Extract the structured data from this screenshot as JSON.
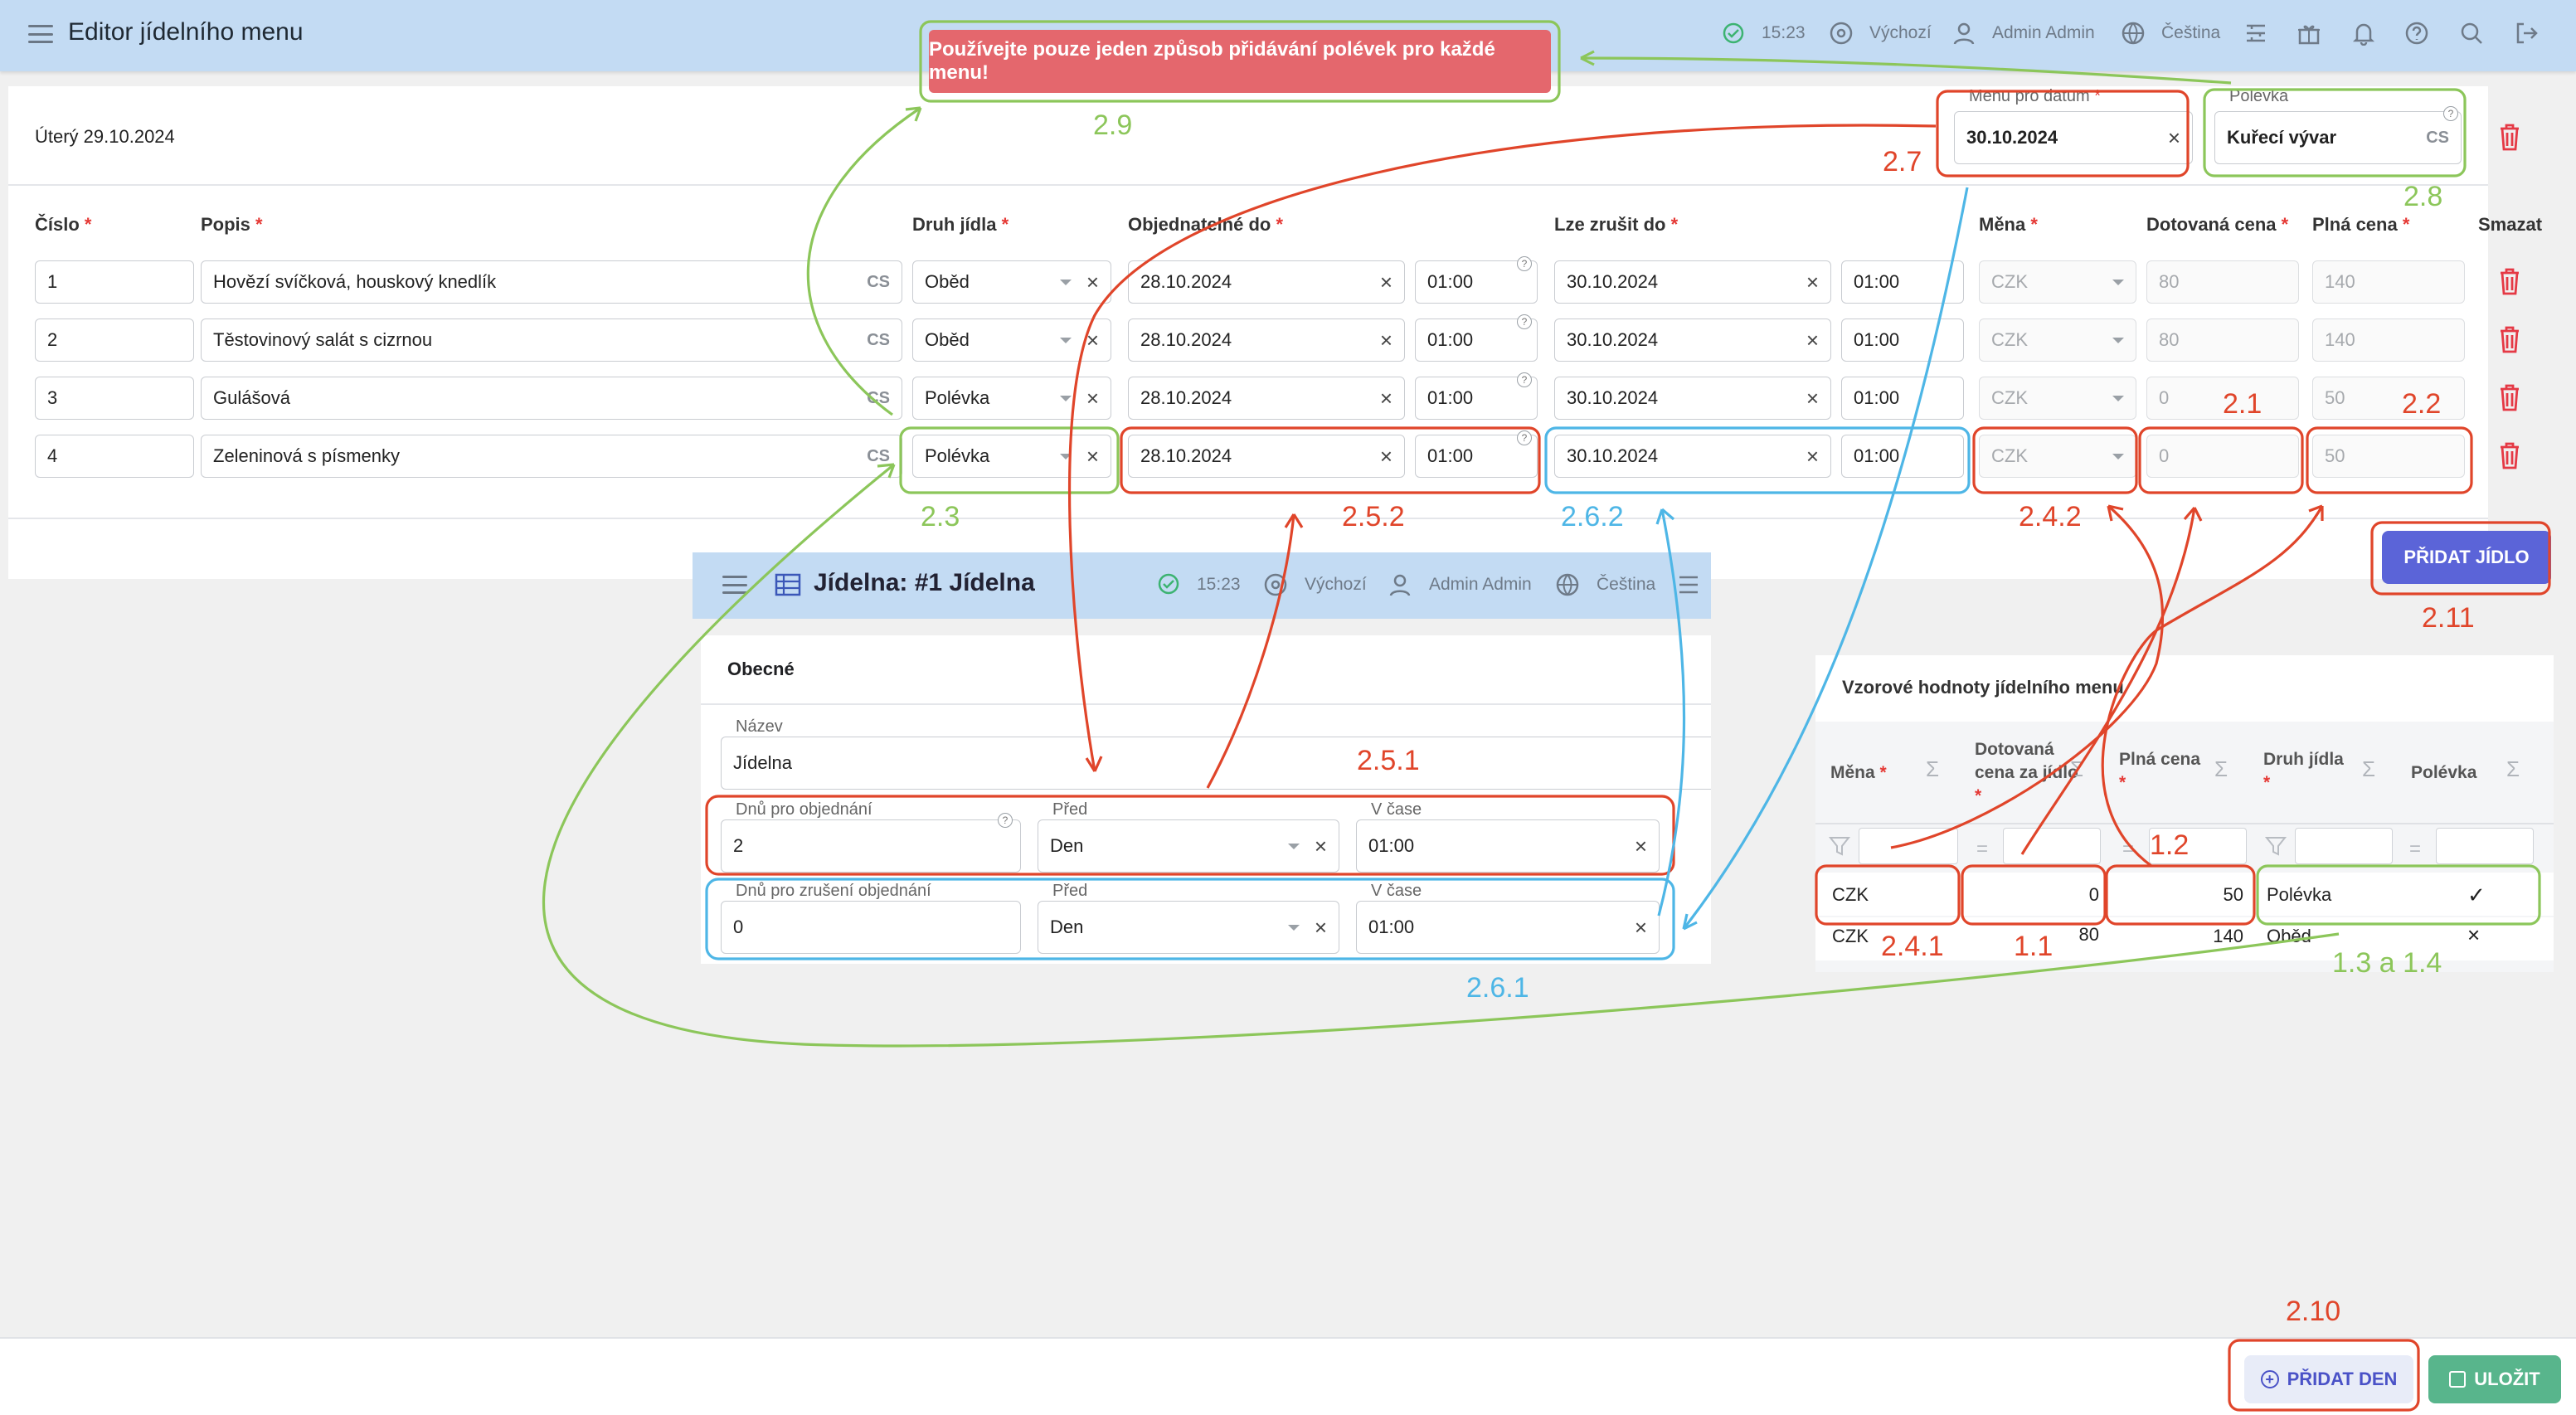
{
  "topbar": {
    "title": "Editor jídelního menu",
    "time": "15:23",
    "profile": "Výchozí",
    "user": "Admin Admin",
    "language": "Čeština"
  },
  "toast": {
    "message": "Používejte pouze jeden způsob přidávání polévek pro každé menu!"
  },
  "day": {
    "title": "Úterý 29.10.2024",
    "menu_date_label": "Menu pro datum",
    "menu_date_value": "30.10.2024",
    "soup_label": "Polévka",
    "soup_value": "Kuřecí vývar",
    "soup_lang": "CS"
  },
  "columns": {
    "number": "Číslo",
    "description": "Popis",
    "food_type": "Druh jídla",
    "order_until": "Objednatelné do",
    "cancel_until": "Lze zrušit do",
    "currency": "Měna",
    "subsidized": "Dotovaná cena",
    "full_price": "Plná cena",
    "delete": "Smazat",
    "required_mark": "*"
  },
  "rows": [
    {
      "num": "1",
      "desc": "Hovězí svíčková, houskový knedlík",
      "lang": "CS",
      "type": "Oběd",
      "order_date": "28.10.2024",
      "order_time": "01:00",
      "cancel_date": "30.10.2024",
      "cancel_time": "01:00",
      "currency": "CZK",
      "subsidized": "80",
      "full": "140"
    },
    {
      "num": "2",
      "desc": "Těstovinový salát s cizrnou",
      "lang": "CS",
      "type": "Oběd",
      "order_date": "28.10.2024",
      "order_time": "01:00",
      "cancel_date": "30.10.2024",
      "cancel_time": "01:00",
      "currency": "CZK",
      "subsidized": "80",
      "full": "140"
    },
    {
      "num": "3",
      "desc": "Gulášová",
      "lang": "CS",
      "type": "Polévka",
      "order_date": "28.10.2024",
      "order_time": "01:00",
      "cancel_date": "30.10.2024",
      "cancel_time": "01:00",
      "currency": "CZK",
      "subsidized": "0",
      "full": "50"
    },
    {
      "num": "4",
      "desc": "Zeleninová s písmenky",
      "lang": "CS",
      "type": "Polévka",
      "order_date": "28.10.2024",
      "order_time": "01:00",
      "cancel_date": "30.10.2024",
      "cancel_time": "01:00",
      "currency": "CZK",
      "subsidized": "0",
      "full": "50"
    }
  ],
  "add_food_button": "PŘIDAT JÍDLO",
  "jidelna": {
    "title": "Jídelna: #1 Jídelna",
    "time": "15:23",
    "profile": "Výchozí",
    "user": "Admin Admin",
    "language": "Čeština",
    "section": "Obecné",
    "name_label": "Název",
    "name_value": "Jídelna",
    "order_days_label": "Dnů pro objednání",
    "order_days_value": "2",
    "before_label": "Před",
    "before_value": "Den",
    "at_time_label": "V čase",
    "at_time_value": "01:00",
    "cancel_days_label": "Dnů pro zrušení objednání",
    "cancel_days_value": "0",
    "before2_value": "Den",
    "at_time2_value": "01:00"
  },
  "sample": {
    "title": "Vzorové hodnoty jídelního menu",
    "col_currency": "Měna",
    "col_subsidized": "Dotovaná cena za jídlo",
    "col_full": "Plná cena",
    "col_type": "Druh jídla",
    "col_soup": "Polévka",
    "rows": [
      {
        "currency": "CZK",
        "subsidized": "0",
        "full": "50",
        "type": "Polévka",
        "soup": "✓"
      },
      {
        "currency": "CZK",
        "subsidized": "80",
        "full": "140",
        "type": "Oběd",
        "soup": "×"
      }
    ]
  },
  "footer": {
    "add_day": "PŘIDAT DEN",
    "save": "ULOŽIT"
  },
  "annotations": {
    "a29": "2.9",
    "a27": "2.7",
    "a28": "2.8",
    "a21": "2.1",
    "a22": "2.2",
    "a23": "2.3",
    "a252": "2.5.2",
    "a262": "2.6.2",
    "a242": "2.4.2",
    "a211": "2.11",
    "a251": "2.5.1",
    "a261": "2.6.1",
    "a12": "1.2",
    "a241": "2.4.1",
    "a11": "1.1",
    "a1314": "1.3 a 1.4",
    "a210": "2.10"
  },
  "colors": {
    "accent": "#5b64d8",
    "save": "#58b58c",
    "danger": "#e53945",
    "bar": "#c3dbf3"
  }
}
